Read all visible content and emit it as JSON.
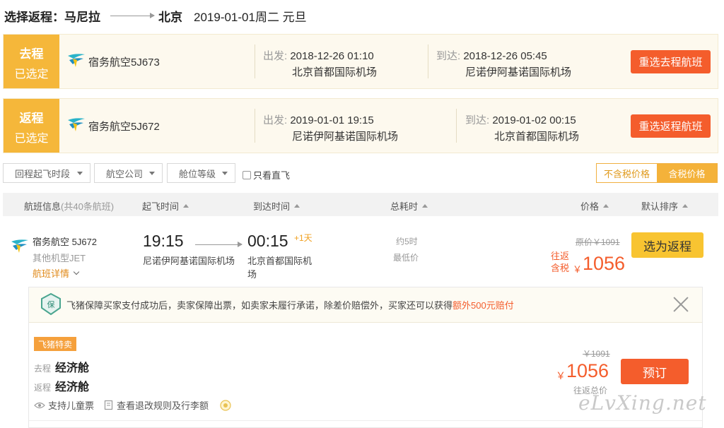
{
  "route_title": {
    "prefix": "选择返程：",
    "from": "马尼拉",
    "to": "北京",
    "date": "2019-01-01周二 元旦"
  },
  "outbound": {
    "tag_line1": "去程",
    "tag_line2": "已选定",
    "airline": "宿务航空5J673",
    "depart_label": "出发:",
    "depart_time": "2018-12-26 01:10",
    "depart_airport": "北京首都国际机场",
    "arrive_label": "到达:",
    "arrive_time": "2018-12-26 05:45",
    "arrive_airport": "尼诺伊阿基诺国际机场",
    "button": "重选去程航班"
  },
  "return": {
    "tag_line1": "返程",
    "tag_line2": "已选定",
    "airline": "宿务航空5J672",
    "depart_label": "出发:",
    "depart_time": "2019-01-01 19:15",
    "depart_airport": "尼诺伊阿基诺国际机场",
    "arrive_label": "到达:",
    "arrive_time": "2019-01-02 00:15",
    "arrive_airport": "北京首都国际机场",
    "button": "重选返程航班"
  },
  "filters": {
    "time_slot": "回程起飞时段",
    "airline": "航空公司",
    "cabin": "舱位等级",
    "direct_only": "只看直飞",
    "tax_excluded": "不含税价格",
    "tax_included": "含税价格"
  },
  "table_header": {
    "flight_info": "航班信息",
    "flight_count": "(共40条航班)",
    "depart_time": "起飞时间",
    "arrive_time": "到达时间",
    "duration": "总耗时",
    "price": "价格",
    "sort": "默认排序"
  },
  "flight": {
    "airline": "宿务航空 5J672",
    "model": "其他机型JET",
    "detail_link": "航班详情",
    "depart_time": "19:15",
    "arrive_time": "00:15",
    "plus_day": "+1天",
    "depart_airport": "尼诺伊阿基诺国际机场",
    "arrive_airport_l1": "北京首都国际机",
    "arrive_airport_l2": "场",
    "duration": "约5时",
    "lowest": "最低价",
    "original_price": "原价￥1091",
    "price_label_l1": "往返",
    "price_label_l2": "含税",
    "currency": "￥",
    "price": "1056",
    "select_button": "选为返程"
  },
  "package": {
    "guarantee_prefix": "飞猪保障买家支付成功后，卖家保障出票，如卖家未履行承诺，除差价赔偿外，买家还可以获得",
    "guarantee_highlight": "额外500元赔付",
    "deal_tag": "飞猪特卖",
    "outbound_label": "去程",
    "outbound_cabin": "经济舱",
    "return_label": "返程",
    "return_cabin": "经济舱",
    "child_ticket": "支持儿童票",
    "rules": "查看退改规则及行李额",
    "original_price": "￥1091",
    "currency": "￥",
    "price": "1056",
    "price_note": "往返总价",
    "book_button": "预订"
  },
  "watermark": "eLvXing.net",
  "colors": {
    "tag_yellow": "#f5b73a",
    "accent_orange": "#f45d2c",
    "select_yellow": "#f8c431",
    "banner_bg": "#fdf9ee"
  }
}
